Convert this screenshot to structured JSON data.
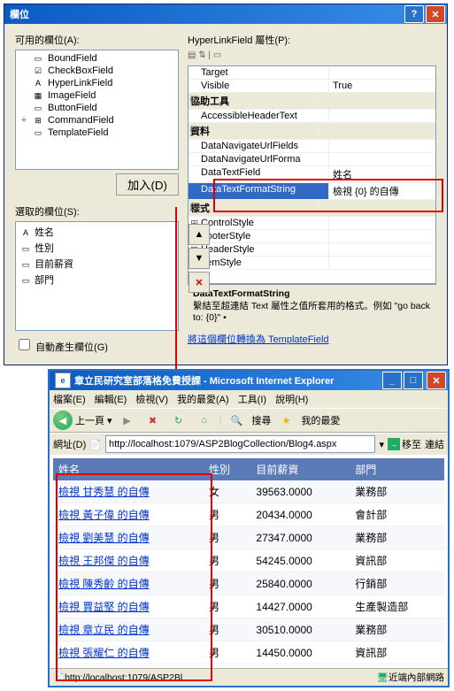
{
  "dialog": {
    "title": "欄位",
    "available_label": "可用的欄位(A):",
    "fields": [
      {
        "name": "BoundField",
        "icon": "▭"
      },
      {
        "name": "CheckBoxField",
        "icon": "☑"
      },
      {
        "name": "HyperLinkField",
        "icon": "A"
      },
      {
        "name": "ImageField",
        "icon": "▦"
      },
      {
        "name": "ButtonField",
        "icon": "▭"
      },
      {
        "name": "CommandField",
        "icon": "⊞",
        "exp": "+"
      },
      {
        "name": "TemplateField",
        "icon": "▭"
      }
    ],
    "add_btn": "加入(D)",
    "selected_label": "選取的欄位(S):",
    "selected": [
      {
        "name": "姓名",
        "icon": "A"
      },
      {
        "name": "性別",
        "icon": "▭"
      },
      {
        "name": "目前薪資",
        "icon": "▭"
      },
      {
        "name": "部門",
        "icon": "▭"
      }
    ],
    "autogen_label": "自動產生欄位(G)",
    "props_label": "HyperLinkField 屬性(P):",
    "props": [
      {
        "n": "Target",
        "v": ""
      },
      {
        "n": "Visible",
        "v": "True"
      },
      {
        "n": "協助工具",
        "cat": true
      },
      {
        "n": "AccessibleHeaderText",
        "v": ""
      },
      {
        "n": "資料",
        "cat": true
      },
      {
        "n": "DataNavigateUrlFields",
        "v": ""
      },
      {
        "n": "DataNavigateUrlForma",
        "v": ""
      },
      {
        "n": "DataTextField",
        "v": "姓名"
      },
      {
        "n": "DataTextFormatString",
        "v": "檢視 {0} 的自傳",
        "sel": true
      },
      {
        "n": "樣式",
        "cat": true
      },
      {
        "n": "ControlStyle",
        "v": "",
        "exp": true
      },
      {
        "n": "FooterStyle",
        "v": "",
        "exp": true
      },
      {
        "n": "HeaderStyle",
        "v": "",
        "exp": true
      },
      {
        "n": "ItemStyle",
        "v": "",
        "exp": true
      }
    ],
    "help_title": "DataTextFormatString",
    "help_text": "繫結至超連結 Text 屬性之值所套用的格式。例如 \"go back to: {0}\" •",
    "template_link": "將這個欄位轉換為 TemplateField"
  },
  "browser": {
    "title": "章立民研究室部落格免費授課 - Microsoft Internet Explorer",
    "menu": [
      "檔案(E)",
      "編輯(E)",
      "檢視(V)",
      "我的最愛(A)",
      "工具(I)",
      "說明(H)"
    ],
    "back_label": "上一頁",
    "search_label": "搜尋",
    "fav_label": "我的最愛",
    "addr_label": "網址(D)",
    "url": "http://localhost:1079/ASP2BlogCollection/Blog4.aspx",
    "go_label": "移至",
    "links_label": "連結",
    "table": {
      "headers": [
        "姓名",
        "性別",
        "目前薪資",
        "部門"
      ],
      "rows": [
        {
          "name": "檢視 甘秀慧 的自傳",
          "gender": "女",
          "salary": "39563.0000",
          "dept": "業務部"
        },
        {
          "name": "檢視 黃子偉 的自傳",
          "gender": "男",
          "salary": "20434.0000",
          "dept": "會計部"
        },
        {
          "name": "檢視 劉美慧 的自傳",
          "gender": "男",
          "salary": "27347.0000",
          "dept": "業務部"
        },
        {
          "name": "檢視 王邦傑 的自傳",
          "gender": "男",
          "salary": "54245.0000",
          "dept": "資訊部"
        },
        {
          "name": "檢視 陳秀齡 的自傳",
          "gender": "男",
          "salary": "25840.0000",
          "dept": "行銷部"
        },
        {
          "name": "檢視 賈益堅 的自傳",
          "gender": "男",
          "salary": "14427.0000",
          "dept": "生產製造部"
        },
        {
          "name": "檢視 章立民 的自傳",
          "gender": "男",
          "salary": "30510.0000",
          "dept": "業務部"
        },
        {
          "name": "檢視 張耀仁 的自傳",
          "gender": "男",
          "salary": "14450.0000",
          "dept": "資訊部"
        }
      ]
    },
    "status_url": "http://localhost:1079/ASP2Bl",
    "status_zone": "近端內部網路"
  }
}
